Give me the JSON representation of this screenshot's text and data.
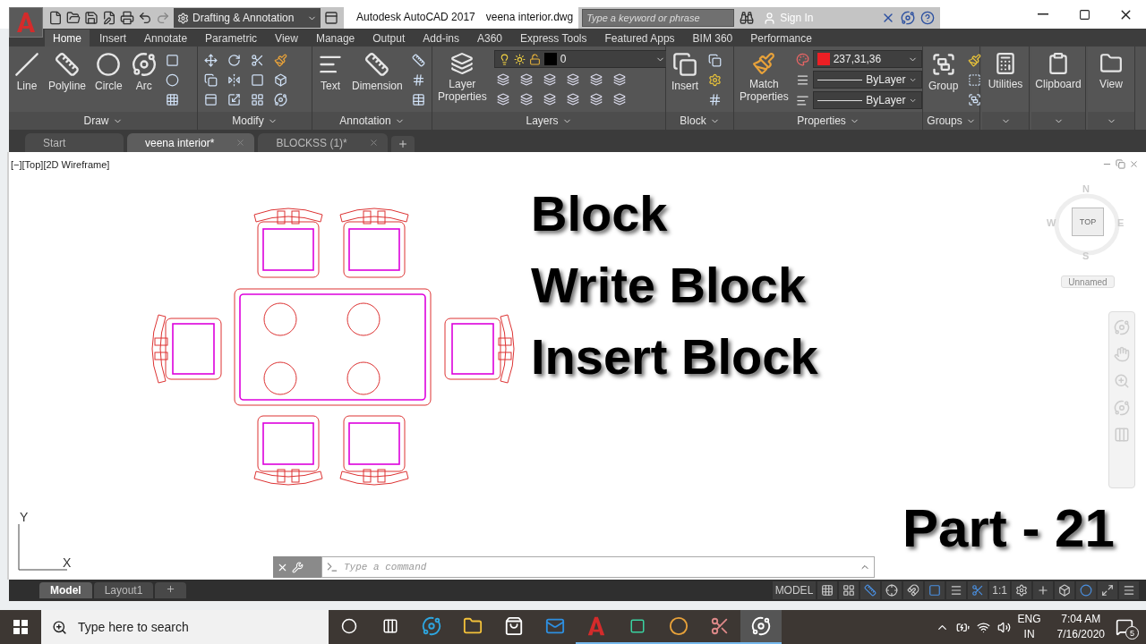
{
  "title_bar": {
    "workspace": "Drafting & Annotation",
    "app_title": "Autodesk AutoCAD 2017",
    "file_name": "veena interior.dwg",
    "search": {
      "placeholder": "Type a keyword or phrase"
    },
    "sign_in": "Sign In"
  },
  "ribbon_tabs": [
    {
      "label": "Home",
      "selected": true
    },
    {
      "label": "Insert",
      "selected": false
    },
    {
      "label": "Annotate",
      "selected": false
    },
    {
      "label": "Parametric",
      "selected": false
    },
    {
      "label": "View",
      "selected": false
    },
    {
      "label": "Manage",
      "selected": false
    },
    {
      "label": "Output",
      "selected": false
    },
    {
      "label": "Add-ins",
      "selected": false
    },
    {
      "label": "A360",
      "selected": false
    },
    {
      "label": "Express Tools",
      "selected": false
    },
    {
      "label": "Featured Apps",
      "selected": false
    },
    {
      "label": "BIM 360",
      "selected": false
    },
    {
      "label": "Performance",
      "selected": false
    }
  ],
  "panels": [
    {
      "kind": "draw",
      "title": "Draw",
      "tools": [
        "Line",
        "Polyline",
        "Circle",
        "Arc"
      ]
    },
    {
      "kind": "modify",
      "title": "Modify"
    },
    {
      "kind": "annotation",
      "title": "Annotation",
      "tools": [
        "Text",
        "Dimension"
      ]
    },
    {
      "kind": "layers",
      "title": "Layers",
      "tools": [
        "Layer Properties"
      ],
      "layer": "0"
    },
    {
      "kind": "block",
      "title": "Block",
      "tools": [
        "Insert"
      ]
    },
    {
      "kind": "properties",
      "title": "Properties",
      "tools": [
        "Match Properties"
      ],
      "color_reading": "237,31,36",
      "linetype": "ByLayer",
      "lineweight": "ByLayer"
    },
    {
      "kind": "groups",
      "title": "Groups",
      "tools": [
        "Group"
      ]
    },
    {
      "kind": "single",
      "tools": [
        "Utilities"
      ]
    },
    {
      "kind": "single",
      "tools": [
        "Clipboard"
      ]
    },
    {
      "kind": "single",
      "tools": [
        "View"
      ]
    }
  ],
  "file_tabs": [
    {
      "label": "Start",
      "selected": false,
      "closable": false
    },
    {
      "label": "veena interior*",
      "selected": true,
      "closable": true
    },
    {
      "label": "BLOCKSS (1)*",
      "selected": false,
      "closable": true
    }
  ],
  "viewport": {
    "label": "[−][Top][2D Wireframe]",
    "headings": [
      "Block",
      "Write Block",
      "Insert Block"
    ],
    "part": "Part - 21",
    "viewcube": {
      "face": "TOP",
      "north": "N",
      "south": "S",
      "east": "E",
      "west": "W",
      "ucs": "Unnamed"
    },
    "ucs_axes": {
      "x": "X",
      "y": "Y"
    }
  },
  "command_line": {
    "placeholder": "Type a command"
  },
  "layout_tabs": [
    {
      "label": "Model",
      "selected": true
    },
    {
      "label": "Layout1",
      "selected": false
    }
  ],
  "status_bar": {
    "model": "MODEL",
    "scale": "1:1"
  },
  "taskbar": {
    "search_placeholder": "Type here to search",
    "language": "ENG",
    "region": "IN",
    "time": "7:04 AM",
    "date": "7/16/2020",
    "notifications": "5"
  }
}
